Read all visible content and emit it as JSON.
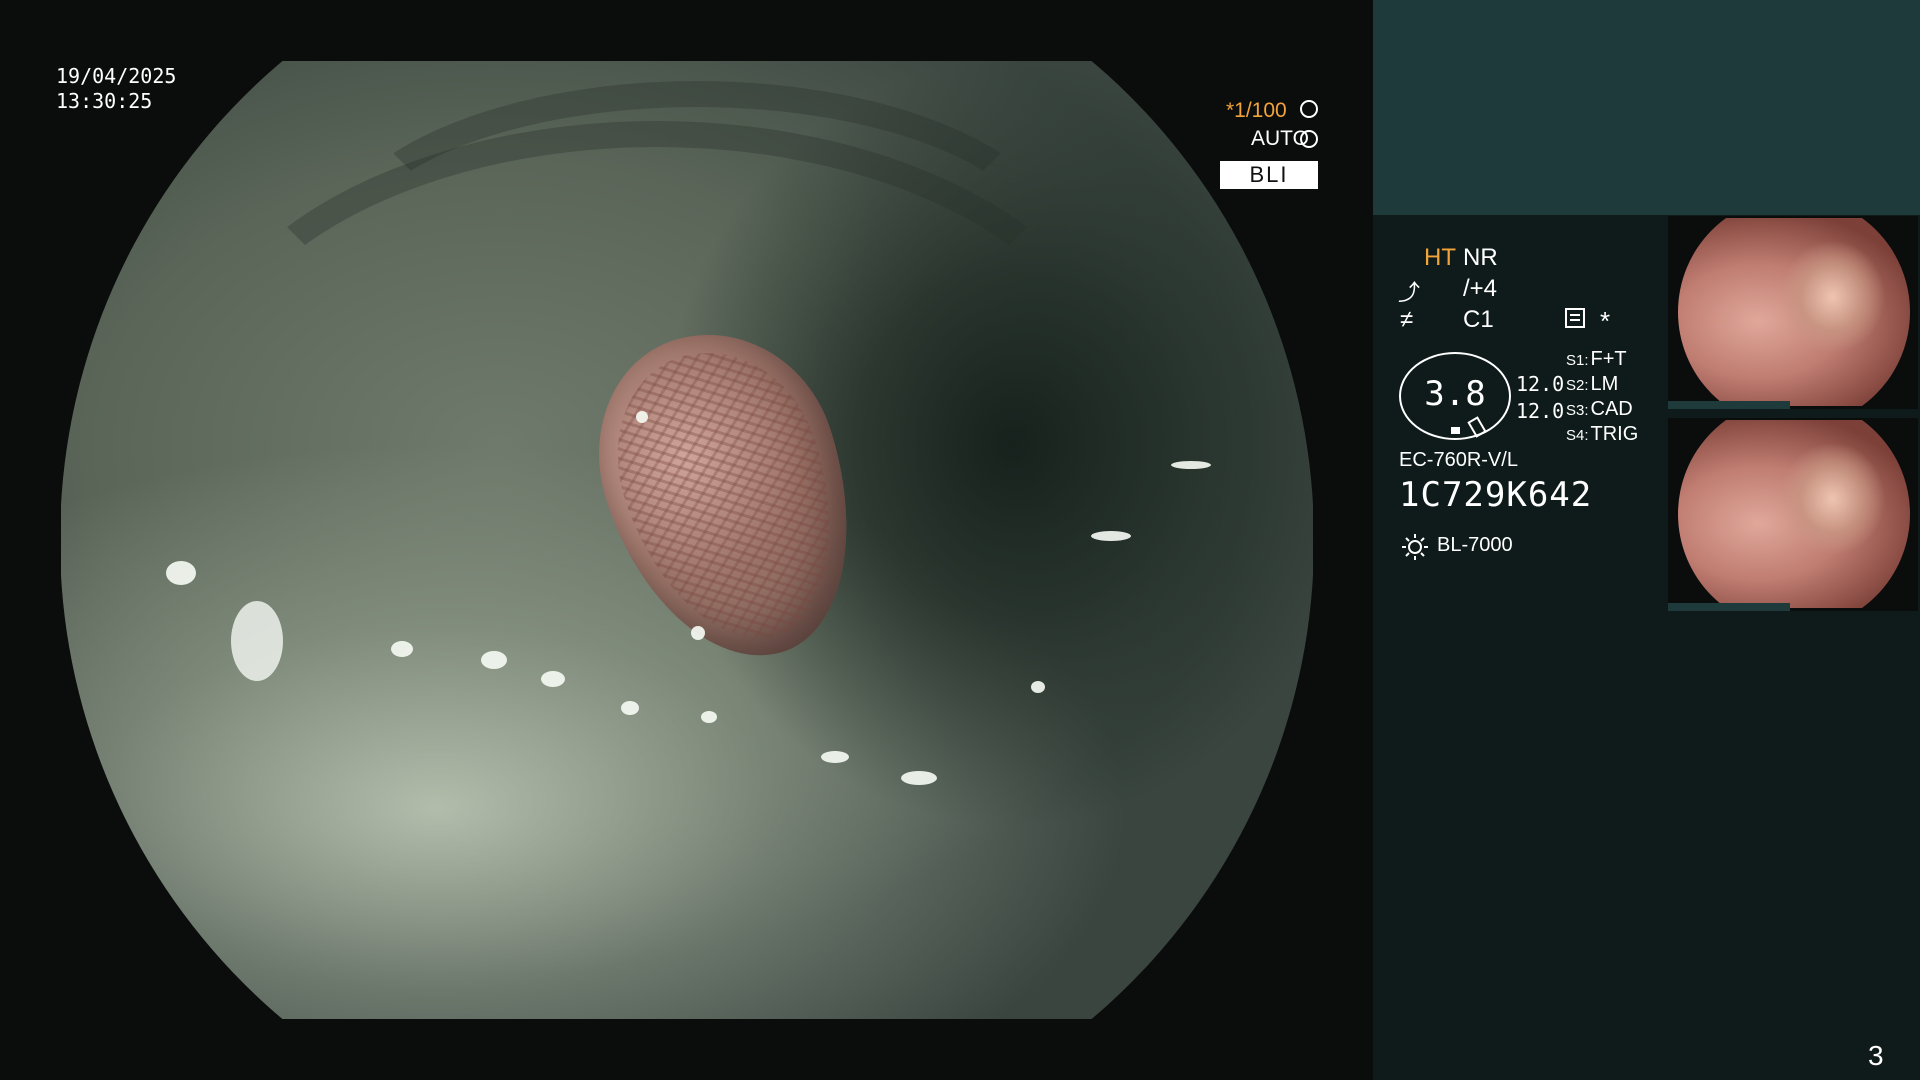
{
  "overlay": {
    "date": "19/04/2025",
    "time": "13:30:25",
    "shutter": "*1/100",
    "shutter_icon": "shutter-icon",
    "iris": "AUTO",
    "iris_icon": "iris-icon",
    "mode": "BLI"
  },
  "panel": {
    "ht": "HT",
    "nr": "NR",
    "enhance_icon": "enhancement-icon",
    "enhance_value": "/+4",
    "color_icon": "color-icon",
    "color_value": "C1",
    "menu_icon": "settings-list-icon",
    "star": "*",
    "gauge_value": "3.8",
    "value_1": "12.0",
    "value_2": "12.0",
    "switches": [
      {
        "key": "S1:",
        "value": "F+T"
      },
      {
        "key": "S2:",
        "value": "LM"
      },
      {
        "key": "S3:",
        "value": "CAD"
      },
      {
        "key": "S4:",
        "value": "TRIG"
      }
    ],
    "scope_model": "EC-760R-V/L",
    "serial": "1C729K642",
    "light_icon": "light-source-icon",
    "light_model": "BL-7000",
    "page_number": "3"
  },
  "colors": {
    "background": "#0b0c0c",
    "panel_top": "#1e3a3a",
    "panel": "#0e1b1a",
    "accent_orange": "#f2a33a"
  }
}
